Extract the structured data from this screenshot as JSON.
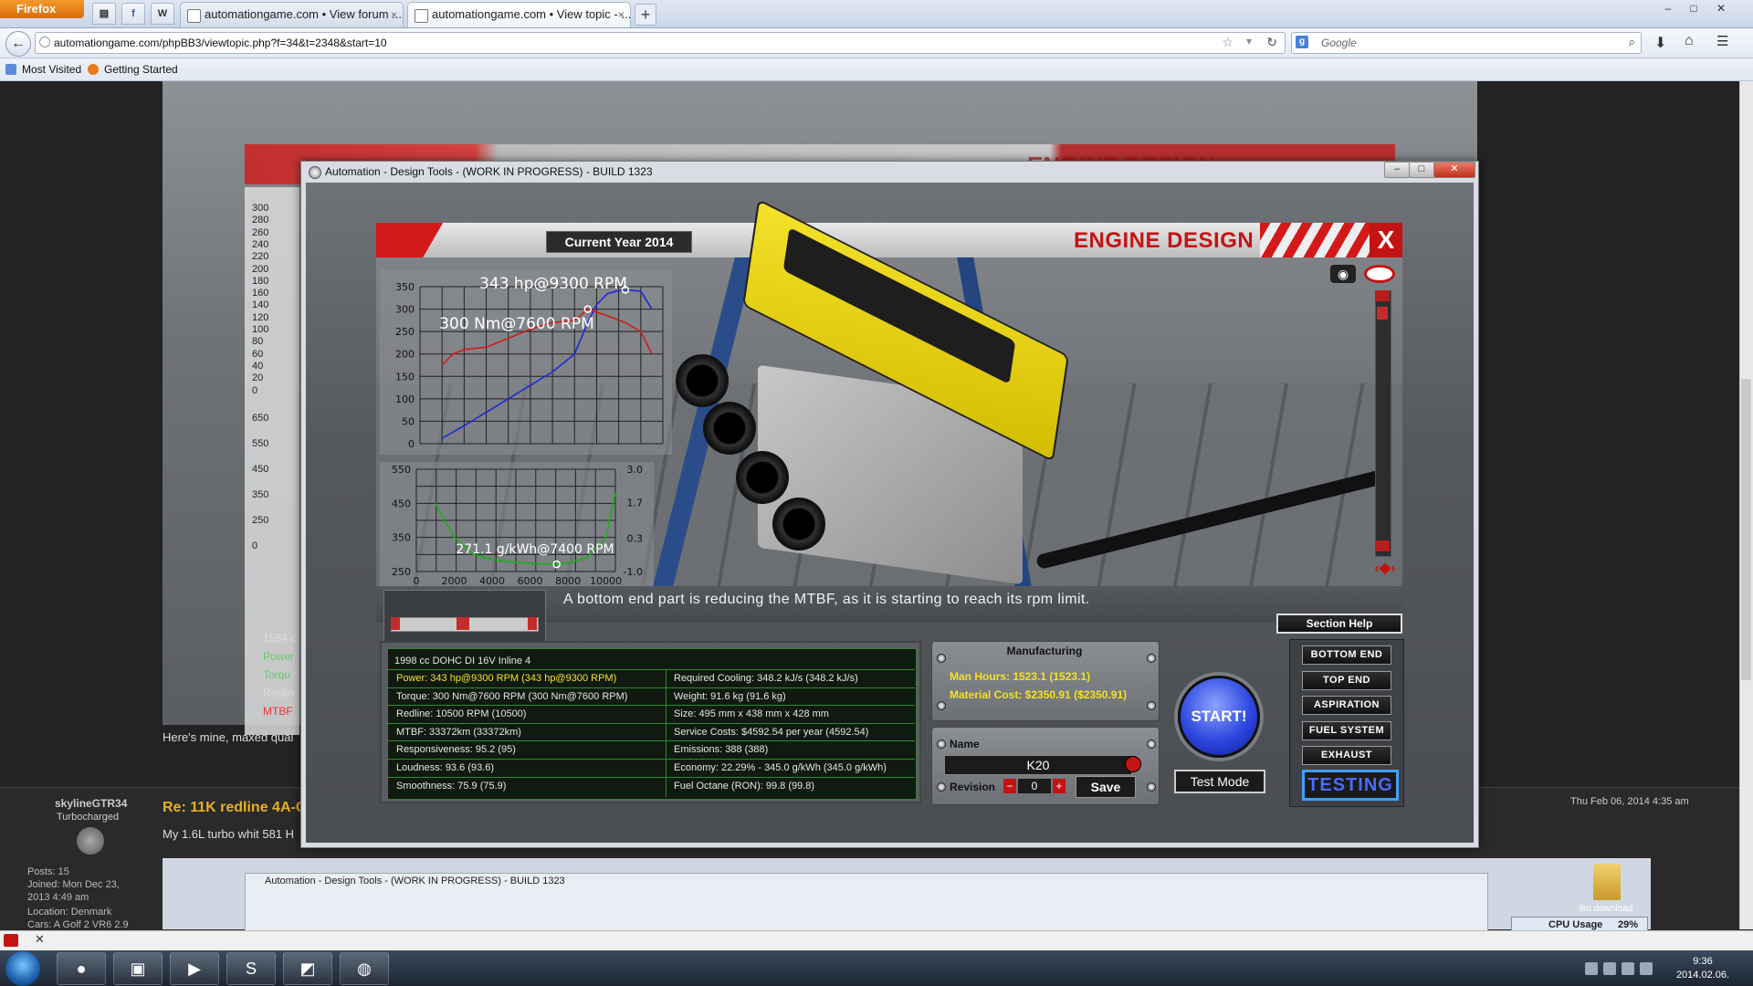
{
  "browser": {
    "menu_label": "Firefox",
    "tabs": [
      {
        "title": "automationgame.com • View forum ..."
      },
      {
        "title": "automationgame.com • View topic - ..."
      }
    ],
    "url": "automationgame.com/phpBB3/viewtopic.php?f=34&t=2348&start=10",
    "search_placeholder": "Google",
    "bookmarks": [
      "Most Visited",
      "Getting Started"
    ]
  },
  "forum": {
    "caption": "Here's mine, maxed qual",
    "post": {
      "username": "skylineGTR34",
      "rank": "Turbocharged",
      "posts": "Posts: 15",
      "joined": "Joined: Mon Dec 23,",
      "joined2": "2013 4:49 am",
      "location": "Location: Denmark",
      "cars": "Cars: A Golf 2 VR6 2.9",
      "title": "Re: 11K redline 4A-G",
      "body": "My 1.6L turbo whit 581 H",
      "date": "Thu Feb 06, 2014 4:35 am",
      "nested_window_title": "Automation - Design Tools - (WORK IN PROGRESS) - BUILD 1323",
      "folder_label": "llm download",
      "cpu_label": "CPU Usage",
      "cpu_value": "29%"
    },
    "bg_ticks": [
      "300",
      "280",
      "260",
      "240",
      "220",
      "200",
      "180",
      "160",
      "140",
      "120",
      "100",
      "80",
      "60",
      "40",
      "20",
      "0",
      "650",
      "550",
      "450",
      "350",
      "250",
      "0"
    ],
    "bg_side_labels": [
      "1584 c",
      "Power",
      "Torqu",
      "Redlin",
      "MTBF"
    ]
  },
  "game": {
    "window_title": "Automation - Design Tools - (WORK IN PROGRESS) - BUILD 1323",
    "current_year": "Current Year 2014",
    "screen_title": "ENGINE DESIGN",
    "message": "A bottom end part is reducing the MTBF, as it is starting to reach its rpm limit.",
    "section_help": "Section Help",
    "stats": {
      "header": "1998 cc DOHC DI 16V Inline 4",
      "left": [
        {
          "text": "Power: 343 hp@9300 RPM (343 hp@9300 RPM)",
          "color": "#f2e12a"
        },
        {
          "text": "Torque: 300 Nm@7600 RPM (300 Nm@7600 RPM)",
          "color": "#e6e6e6"
        },
        {
          "text": "Redline: 10500 RPM (10500)",
          "color": "#e6e6e6"
        },
        {
          "text": "MTBF: 33372km (33372km)",
          "color": "#e6e6e6"
        },
        {
          "text": "Responsiveness: 95.2 (95)",
          "color": "#e6e6e6"
        },
        {
          "text": "Loudness: 93.6 (93.6)",
          "color": "#e6e6e6"
        },
        {
          "text": "Smoothness: 75.9 (75.9)",
          "color": "#e6e6e6"
        }
      ],
      "right": [
        {
          "text": "Required Cooling: 348.2 kJ/s (348.2 kJ/s)",
          "color": "#e6e6e6"
        },
        {
          "text": "Weight: 91.6 kg (91.6 kg)",
          "color": "#e6e6e6"
        },
        {
          "text": "Size: 495 mm x 438 mm x 428 mm",
          "color": "#e6e6e6"
        },
        {
          "text": "Service Costs: $4592.54 per year (4592.54)",
          "color": "#e6e6e6"
        },
        {
          "text": "Emissions: 388 (388)",
          "color": "#e6e6e6"
        },
        {
          "text": "Economy: 22.29% - 345.0 g/kWh (345.0 g/kWh)",
          "color": "#e6e6e6"
        },
        {
          "text": "Fuel Octane (RON): 99.8 (99.8)",
          "color": "#e6e6e6"
        }
      ]
    },
    "manufacturing": {
      "title": "Manufacturing",
      "man_hours": "Man Hours: 1523.1 (1523.1)",
      "material_cost": "Material Cost: $2350.91 ($2350.91)"
    },
    "name_panel": {
      "name_label": "Name",
      "name_value": "K20",
      "revision_label": "Revision",
      "revision_value": "0",
      "save_label": "Save"
    },
    "start_label": "START!",
    "test_mode_label": "Test Mode",
    "sections": [
      "BOTTOM END",
      "TOP END",
      "ASPIRATION",
      "FUEL SYSTEM",
      "EXHAUST"
    ],
    "testing_label": "TESTING"
  },
  "taskbar": {
    "time": "9:36",
    "date": "2014.02.06."
  },
  "chart_data": [
    {
      "type": "line",
      "title": "",
      "x_range": [
        0,
        11000
      ],
      "ylim": [
        0,
        350
      ],
      "y_ticks": [
        0,
        50,
        100,
        150,
        200,
        250,
        300,
        350
      ],
      "annotations": [
        "343 hp@9300 RPM",
        "300 Nm@7600 RPM"
      ],
      "series": [
        {
          "color": "#1d2bd9",
          "x": [
            1000,
            2000,
            3000,
            4000,
            5000,
            6000,
            7000,
            7600,
            8000,
            8500,
            9000,
            9300,
            10000,
            10500
          ],
          "values": [
            12,
            40,
            70,
            100,
            130,
            160,
            200,
            270,
            310,
            335,
            341,
            343,
            340,
            300
          ]
        },
        {
          "color": "#d41c1c",
          "x": [
            1000,
            1500,
            2000,
            3000,
            4000,
            5000,
            6000,
            7000,
            7600,
            8500,
            9300,
            10000,
            10500
          ],
          "values": [
            175,
            200,
            210,
            215,
            235,
            255,
            270,
            275,
            300,
            285,
            270,
            250,
            200
          ]
        }
      ]
    },
    {
      "type": "line",
      "title": "",
      "x_ticks": [
        0,
        2000,
        4000,
        6000,
        8000,
        10000
      ],
      "ylim": [
        250,
        550
      ],
      "y_ticks": [
        250,
        350,
        450,
        550
      ],
      "y2_ticks": [
        -1.0,
        0.3,
        1.7,
        3.0
      ],
      "annotations": [
        "271.1 g/kWh@7400 RPM"
      ],
      "series": [
        {
          "color": "#19b019",
          "x": [
            1000,
            2000,
            3000,
            4000,
            5000,
            6000,
            7000,
            7400,
            8000,
            9000,
            10000,
            10500
          ],
          "values": [
            450,
            350,
            300,
            285,
            278,
            274,
            272,
            271,
            275,
            290,
            350,
            480
          ]
        }
      ]
    }
  ]
}
